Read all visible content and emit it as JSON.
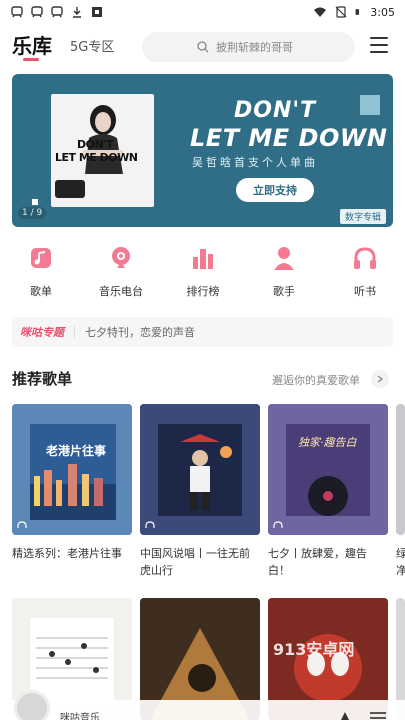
{
  "status_bar": {
    "time": "3:05",
    "left_icons": [
      "app-notification-icon",
      "app-notification-icon",
      "app-notification-icon",
      "download-icon",
      "square-app-icon"
    ],
    "right_icons": [
      "wifi-icon",
      "no-sim-icon",
      "battery-icon"
    ]
  },
  "header": {
    "title": "乐库",
    "tab_5g": "5G专区",
    "search_placeholder": "披荆斩棘的哥哥"
  },
  "banner": {
    "headline_line1": "DON'T",
    "headline_line2": "LET ME DOWN",
    "subtitle": "吴哲晗首支个人单曲",
    "cover_text_line1": "DON'T",
    "cover_text_line2": "LET ME DOWN",
    "button": "立即支持",
    "pager": "1 / 9",
    "tag": "数字专辑",
    "bg_color": "#2f6e86"
  },
  "categories": [
    {
      "label": "歌单",
      "icon": "song-list-icon"
    },
    {
      "label": "音乐电台",
      "icon": "radio-icon"
    },
    {
      "label": "排行榜",
      "icon": "chart-bars-icon"
    },
    {
      "label": "歌手",
      "icon": "singer-icon"
    },
    {
      "label": "听书",
      "icon": "headphones-icon"
    }
  ],
  "promo": {
    "badge": "咪咕专题",
    "text": "七夕特刊，恋爱的声音"
  },
  "recommend": {
    "title": "推荐歌单",
    "more": "邂逅你的真爱歌单",
    "playlists": [
      {
        "title": "精选系列：老港片往事",
        "cover_text": "老港片往事"
      },
      {
        "title": "中国风说唱丨一往无前虎山行",
        "cover_text": ""
      },
      {
        "title": "七夕丨放肆爱，趣告白！",
        "cover_text": "独家·趣告白"
      },
      {
        "title": "绿净",
        "cover_text": ""
      }
    ]
  },
  "watermark": "913安卓网",
  "player": {
    "song": "咪咕音乐"
  },
  "colors": {
    "accent": "#f0506e"
  }
}
